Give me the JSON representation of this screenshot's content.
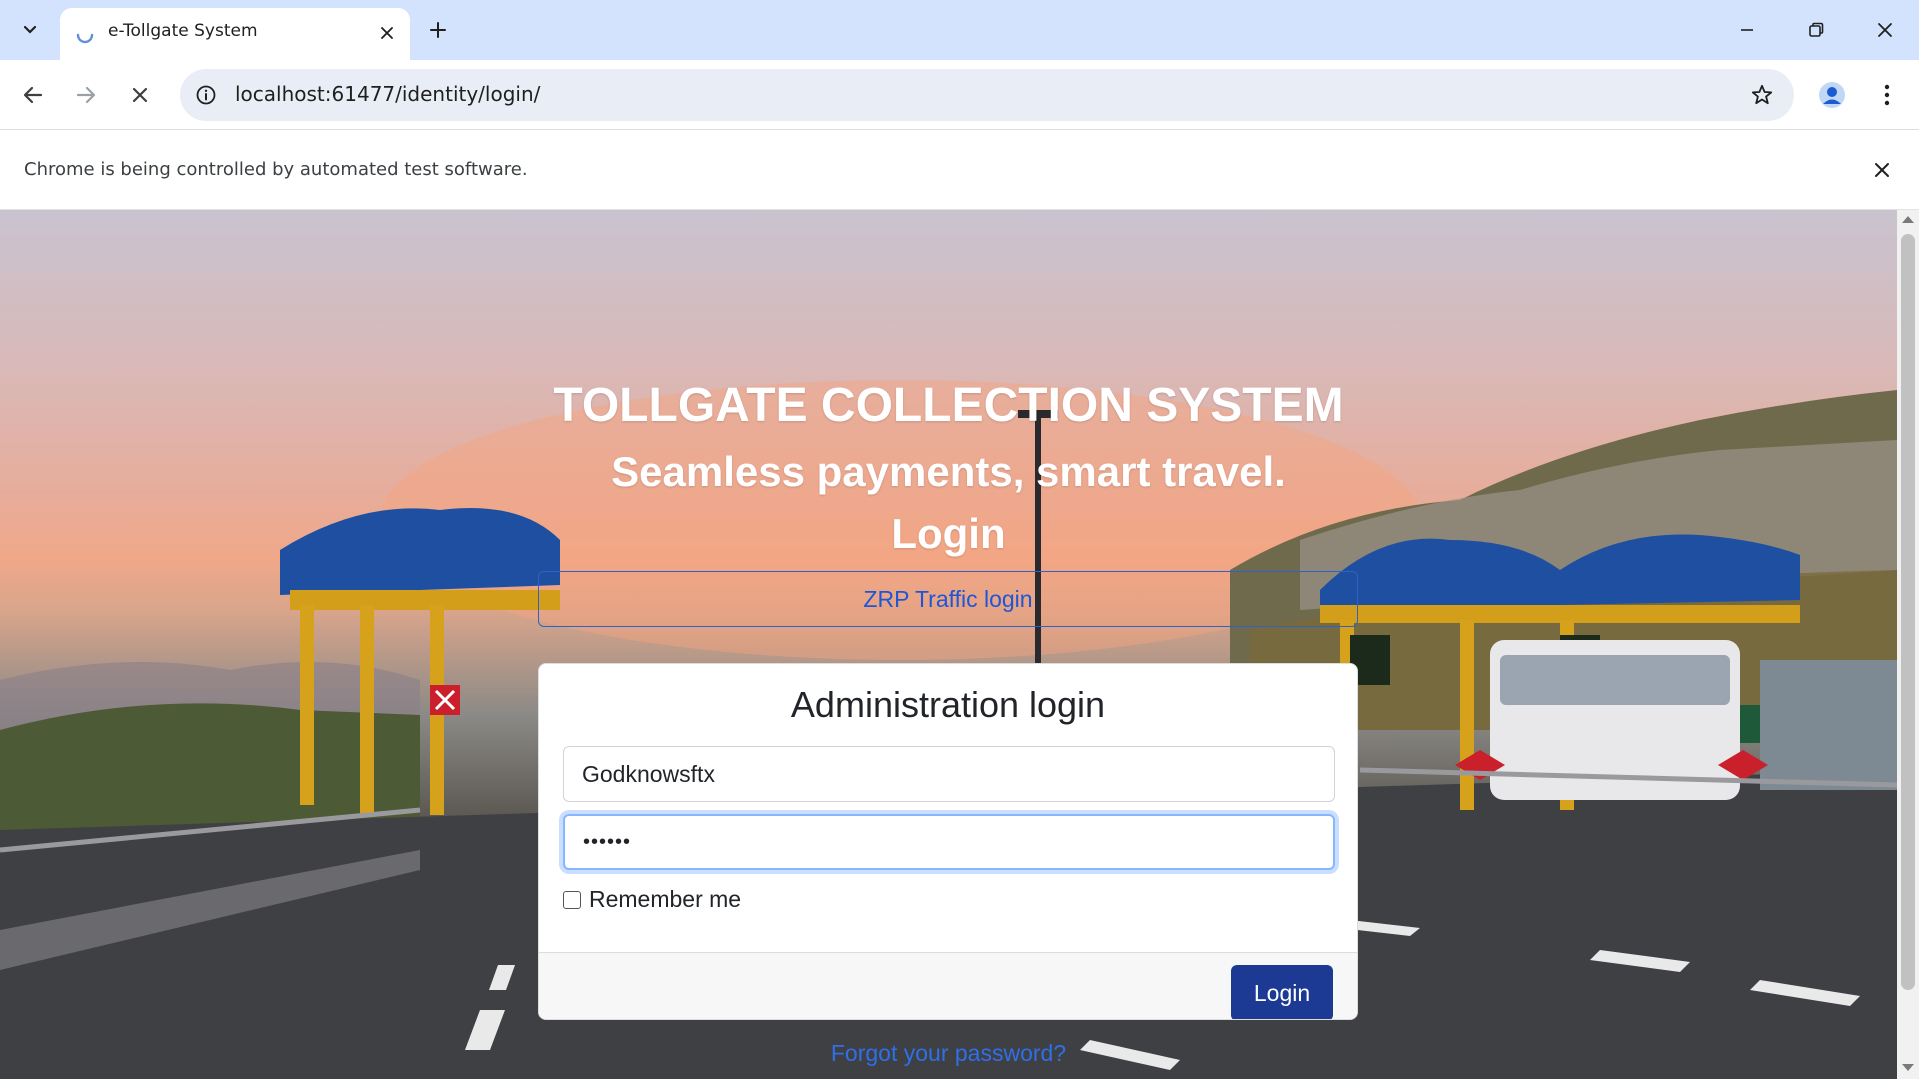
{
  "browser": {
    "tab_title": "e-Tollgate System",
    "url": "localhost:61477/identity/login/",
    "infobar_text": "Chrome is being controlled by automated test software."
  },
  "page": {
    "title": "TOLLGATE COLLECTION SYSTEM",
    "tagline": "Seamless payments, smart travel.",
    "login_heading": "Login",
    "zrp_button": "ZRP Traffic login",
    "admin_title": "Administration login",
    "username_value": "Godknowsftx",
    "password_value": "••••••",
    "remember_label": "Remember me",
    "remember_checked": false,
    "login_button": "Login",
    "forgot_link": "Forgot your password?"
  },
  "icons": {
    "tab_search": "chevron-down-icon",
    "tab_loading": "spinner-icon",
    "tab_close": "close-icon",
    "new_tab": "plus-icon",
    "back": "arrow-left-icon",
    "forward": "arrow-right-icon",
    "stop": "stop-icon",
    "site_info": "info-icon",
    "bookmark": "star-icon",
    "profile": "person-icon",
    "menu": "kebab-icon"
  },
  "colors": {
    "tabstrip": "#d3e3fd",
    "brand_button": "#1c3a93",
    "link": "#2f6fe8",
    "focus_ring": "#86b7fe"
  }
}
